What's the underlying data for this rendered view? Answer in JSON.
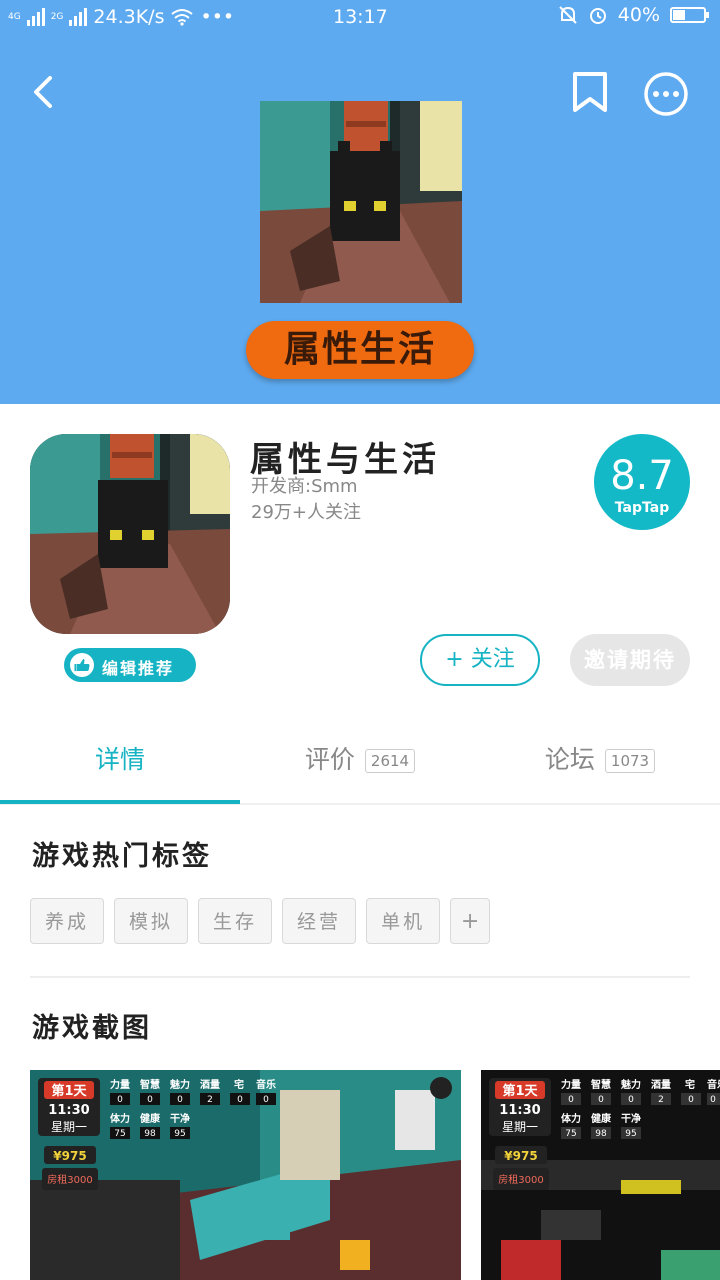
{
  "status_bar": {
    "network_1": "4G",
    "network_2": "2G",
    "speed": "24.3K/s",
    "dots": "•••",
    "time": "13:17",
    "battery": "40%"
  },
  "header": {
    "banner_title": "属性生活"
  },
  "app": {
    "name": "属性与生活",
    "developer": "开发商:Smm",
    "followers": "29万+人关注",
    "score": "8.7",
    "score_brand": "TapTap",
    "editor_badge": "编辑推荐",
    "follow_label": "+ 关注",
    "invite_label": "邀请期待"
  },
  "tabs": [
    {
      "label": "详情",
      "count": ""
    },
    {
      "label": "评价",
      "count": "2614"
    },
    {
      "label": "论坛",
      "count": "1073"
    }
  ],
  "sections": {
    "tags_title": "游戏热门标签",
    "screenshots_title": "游戏截图"
  },
  "tags": [
    "养成",
    "模拟",
    "生存",
    "经营",
    "单机",
    "+"
  ],
  "screenshot_hud": {
    "day": "第1天",
    "clock": "11:30",
    "weekday": "星期一",
    "money": "¥975",
    "rent": "房租3000",
    "stat_row1": [
      "力量",
      "智慧",
      "魅力",
      "酒量",
      "宅",
      "音乐"
    ],
    "stat_row1_values": [
      "0",
      "0",
      "0",
      "2",
      "0",
      "0"
    ],
    "stat_row2": [
      "体力",
      "健康",
      "干净"
    ],
    "stat_row2_values": [
      "75",
      "98",
      "95"
    ]
  },
  "colors": {
    "header_bg": "#5eaaf0",
    "accent": "#15b3c3",
    "banner_pill": "#f06a10"
  }
}
